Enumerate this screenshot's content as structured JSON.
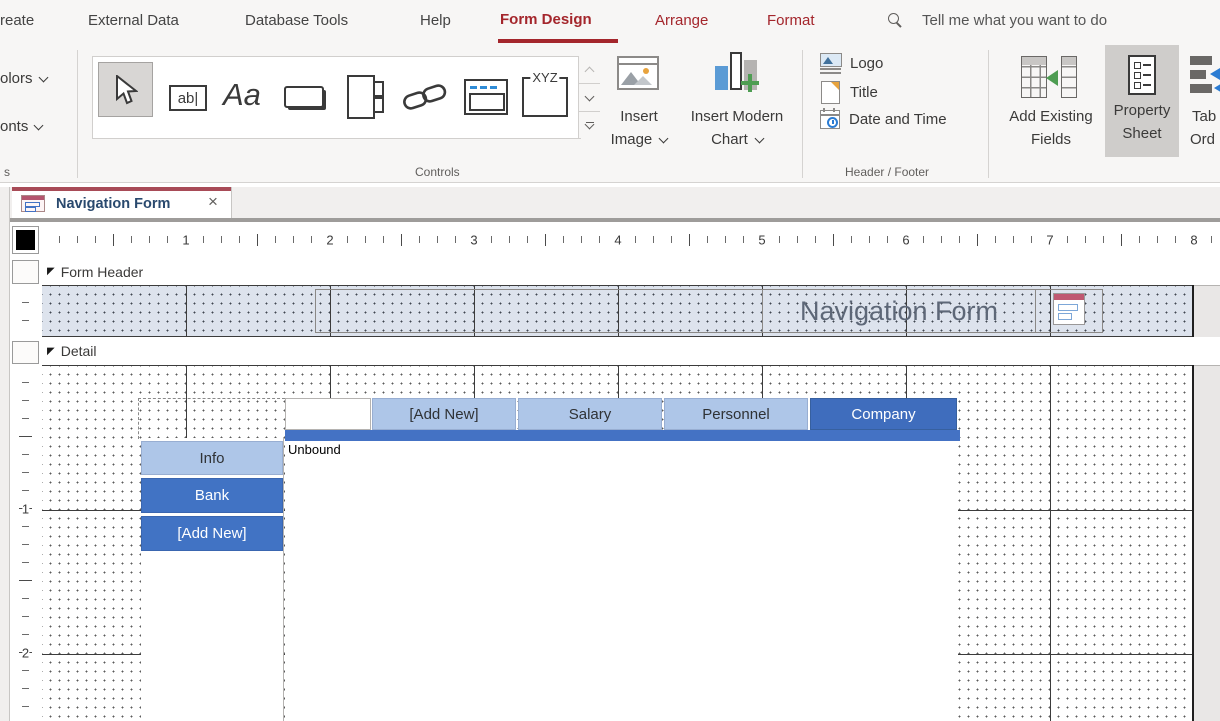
{
  "icons": {
    "section_marker": "◤",
    "textbox_glyph": "ab|",
    "label_glyph": "Aa",
    "unbound_glyph": "XYZ"
  },
  "ribbon": {
    "tabs": [
      {
        "label": "reate"
      },
      {
        "label": "External Data"
      },
      {
        "label": "Database Tools"
      },
      {
        "label": "Help"
      },
      {
        "label": "Form Design"
      },
      {
        "label": "Arrange"
      },
      {
        "label": "Format"
      }
    ],
    "tell_me": "Tell me what you want to do",
    "left_partial": {
      "colors": "olors",
      "fonts": "onts",
      "group_label": "s"
    },
    "controls_group": {
      "label": "Controls"
    },
    "insert_image": {
      "line1": "Insert",
      "line2": "Image"
    },
    "insert_modern_chart": {
      "line1": "Insert Modern",
      "line2": "Chart"
    },
    "header_footer": {
      "label": "Header / Footer",
      "logo": "Logo",
      "title": "Title",
      "date_time": "Date and Time"
    },
    "tools_group": {
      "add_existing_1": "Add Existing",
      "add_existing_2": "Fields",
      "property_1": "Property",
      "property_2": "Sheet",
      "tab_order_1": "Tab",
      "tab_order_2": "Ord"
    }
  },
  "document_tab": {
    "title": "Navigation Form",
    "close": "×"
  },
  "canvas": {
    "h_ruler": [
      "1",
      "2",
      "3",
      "4",
      "5",
      "6",
      "7",
      "8"
    ],
    "v_ruler": [
      "1",
      "2"
    ],
    "form_header": {
      "label": "Form Header",
      "title": "Navigation Form"
    },
    "detail": {
      "label": "Detail",
      "unbound": "Unbound"
    },
    "nav_h_tabs": [
      {
        "label": "[Add New]",
        "selected": false
      },
      {
        "label": "Salary",
        "selected": false
      },
      {
        "label": "Personnel",
        "selected": false
      },
      {
        "label": "Company",
        "selected": true
      }
    ],
    "nav_v_tabs": [
      {
        "label": "Info",
        "selected": false
      },
      {
        "label": "Bank",
        "selected": true
      },
      {
        "label": "[Add New]",
        "selected": true
      }
    ]
  },
  "colors": {
    "accent_red": "#A4262C",
    "nav_bar_blue": "#4472C4",
    "nav_light_blue": "#AEC6E8",
    "nav_selected_blue": "#3F6DBD",
    "header_title_gray": "#5D6777"
  }
}
